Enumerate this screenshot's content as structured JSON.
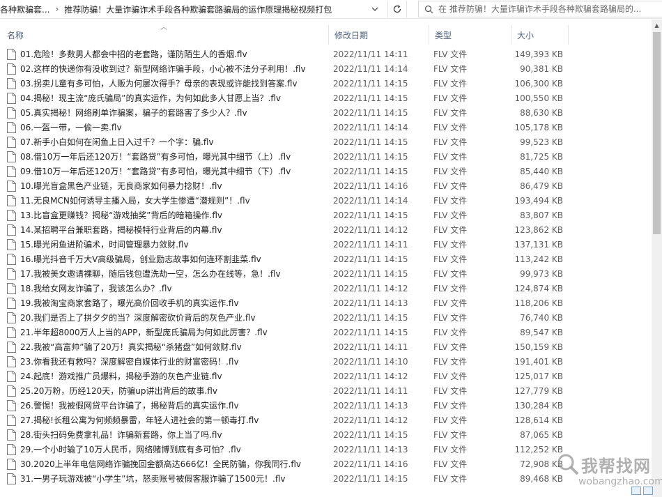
{
  "address": {
    "crumb_parent": "各种欺骗套...",
    "crumb_current": "推荐防骗！大量诈骗诈术手段各种欺骗套路骗局的运作原理揭秘视频打包",
    "separator": "›",
    "search_placeholder": "在 推荐防骗！大量诈骗诈术手段各种欺骗套路骗局的..."
  },
  "columns": {
    "name": "名称",
    "date": "修改日期",
    "type": "类型",
    "size": "大小"
  },
  "files": [
    {
      "name": "01.危险！多数男人都会中招的老套路，谨防陌生人的香烟.flv",
      "date": "2022/11/11 14:11",
      "type": "FLV 文件",
      "size": "149,393 KB"
    },
    {
      "name": "02.这样的快递你有没收到过？新型网络诈骗手段，小心被不法分子利用！.flv",
      "date": "2022/11/11 14:14",
      "type": "FLV 文件",
      "size": "90,381 KB"
    },
    {
      "name": "03.拐卖儿童有多可怕，人贩为何屡次得手？母亲的表现或许能找到答案.flv",
      "date": "2022/11/11 14:15",
      "type": "FLV 文件",
      "size": "106,300 KB"
    },
    {
      "name": "04.揭秘！现主流“庞氏骗局”的真实运作，为何如此多人甘愿上当？.flv",
      "date": "2022/11/11 14:15",
      "type": "FLV 文件",
      "size": "100,550 KB"
    },
    {
      "name": "05.真实揭秘！网络刷单诈骗案，骗子的套路害了多少人？.flv",
      "date": "2022/11/11 14:15",
      "type": "FLV 文件",
      "size": "88,630 KB"
    },
    {
      "name": "06.一盔一带，一偷一卖.flv",
      "date": "2022/11/11 14:14",
      "type": "FLV 文件",
      "size": "105,178 KB"
    },
    {
      "name": "07.新手小白如何在闲鱼上日入过千？一个字：骗.flv",
      "date": "2022/11/11 14:15",
      "type": "FLV 文件",
      "size": "99,523 KB"
    },
    {
      "name": "08.借10万一年后还120万！“套路贷”有多可怕，曝光其中细节（上）.flv",
      "date": "2022/11/11 14:15",
      "type": "FLV 文件",
      "size": "81,725 KB"
    },
    {
      "name": "09.借10万一年后还120万！“套路贷”有多可怕，曝光其中细节（下）.flv",
      "date": "2022/11/11 14:15",
      "type": "FLV 文件",
      "size": "85,440 KB"
    },
    {
      "name": "10.曝光盲盒黑色产业链，无良商家如何暴力捻财！.flv",
      "date": "2022/11/11 14:16",
      "type": "FLV 文件",
      "size": "86,479 KB"
    },
    {
      "name": "11.无良MCN如何诱导主播入局，女大学生惨遭“潜规则”！.flv",
      "date": "2022/11/11 14:14",
      "type": "FLV 文件",
      "size": "193,494 KB"
    },
    {
      "name": "13.比盲盒更赚钱？揭秘“游戏抽奖”背后的暗箱操作.flv",
      "date": "2022/11/11 14:15",
      "type": "FLV 文件",
      "size": "83,807 KB"
    },
    {
      "name": "14.某招聘平台兼职套路，揭秘模特行业背后的内幕.flv",
      "date": "2022/11/11 14:12",
      "type": "FLV 文件",
      "size": "123,862 KB"
    },
    {
      "name": "15.曝光闲鱼进阶骗术，时间管理暴力敛财.flv",
      "date": "2022/11/11 14:11",
      "type": "FLV 文件",
      "size": "137,131 KB"
    },
    {
      "name": "16.曝光抖音千万大V高级骗局，创业励志故事如何连环割韭菜.flv",
      "date": "2022/11/11 14:15",
      "type": "FLV 文件",
      "size": "113,242 KB"
    },
    {
      "name": "17.我被美女邀请裸聊，随后钱包遭洗劫一空，怎么办在线等，急！.flv",
      "date": "2022/11/11 14:15",
      "type": "FLV 文件",
      "size": "99,973 KB"
    },
    {
      "name": "18.我给女网友诈骗了，我该怎么办？.flv",
      "date": "2022/11/11 14:12",
      "type": "FLV 文件",
      "size": "124,874 KB"
    },
    {
      "name": "19.我被淘宝商家套路了，曝光高价回收手机的真实运作.flv",
      "date": "2022/11/11 14:13",
      "type": "FLV 文件",
      "size": "118,206 KB"
    },
    {
      "name": "20.我们是否上了拼夕夕的当？深度解密砍价背后的灰色产业.flv",
      "date": "2022/11/11 14:15",
      "type": "FLV 文件",
      "size": "76,740 KB"
    },
    {
      "name": "21.半年超8000万人上当的APP，新型庞氏骗局为何如此厉害？.flv",
      "date": "2022/11/11 14:15",
      "type": "FLV 文件",
      "size": "89,547 KB"
    },
    {
      "name": "22.我被“高富帅”骗了20万！真实揭秘“杀猪盘”如何敛财.flv",
      "date": "2022/11/11 14:11",
      "type": "FLV 文件",
      "size": "150,159 KB"
    },
    {
      "name": "23.你看我还有救吗？深度解密自媒体行业的财富密码！.flv",
      "date": "2022/11/11 14:10",
      "type": "FLV 文件",
      "size": "191,401 KB"
    },
    {
      "name": "24.起底！游戏推广员爆料，揭秘手游的灰色产业链.flv",
      "date": "2022/11/11 14:12",
      "type": "FLV 文件",
      "size": "125,017 KB"
    },
    {
      "name": "25.20万粉，历经120天，防骗up讲出背后的故事.flv",
      "date": "2022/11/11 14:11",
      "type": "FLV 文件",
      "size": "127,779 KB"
    },
    {
      "name": "26.警惕！我被假网贷平台诈骗了，揭秘背后的真实运作.flv",
      "date": "2022/11/11 14:13",
      "type": "FLV 文件",
      "size": "130,284 KB"
    },
    {
      "name": "27.揭秘!长租公寓为何频频暴雷，年轻人进社会的第一顿毒打.flv",
      "date": "2022/11/11 14:12",
      "type": "FLV 文件",
      "size": "128,614 KB"
    },
    {
      "name": "28.街头扫码免费拿礼品！诈骗新套路，你上当了吗.flv",
      "date": "2022/11/11 14:15",
      "type": "FLV 文件",
      "size": "87,065 KB"
    },
    {
      "name": "29.一个小时输了10万人民币，网络赌博到底有多可怕？.flv",
      "date": "2022/11/11 14:13",
      "type": "FLV 文件",
      "size": "112,252 KB"
    },
    {
      "name": "30.2020上半年电信网络诈骗挽回金额高达666亿！全民防骗，你我同行.flv",
      "date": "2022/11/11 14:16",
      "type": "FLV 文件",
      "size": "72,908 KB"
    },
    {
      "name": "31.一男子玩游戏被“小学生”坑，怒卖账号被假客服诈骗了1500元！.flv",
      "date": "2022/11/11 14:15",
      "type": "FLV 文件",
      "size": "89,468 KB"
    }
  ],
  "watermark": {
    "cn": "我帮找网",
    "en": "wobangzhao.com"
  }
}
